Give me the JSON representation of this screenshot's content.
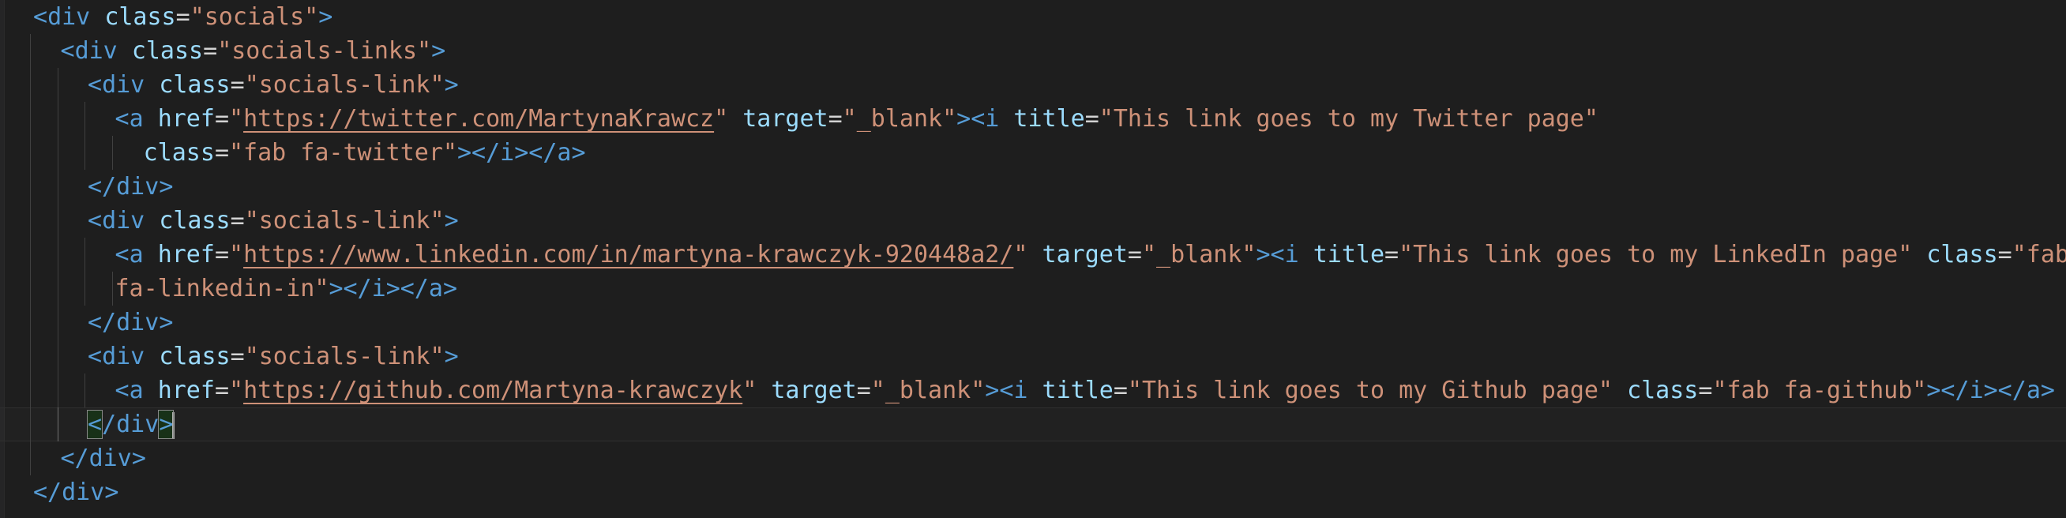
{
  "editor": {
    "language": "html",
    "lines": [
      {
        "indent": 0,
        "tokens": [
          {
            "t": "tag-open",
            "v": "<"
          },
          {
            "t": "tag",
            "v": "div"
          },
          {
            "t": "txt",
            "v": " "
          },
          {
            "t": "attr",
            "v": "class"
          },
          {
            "t": "txt",
            "v": "="
          },
          {
            "t": "str",
            "v": "\"socials\""
          },
          {
            "t": "tag-open",
            "v": ">"
          }
        ]
      },
      {
        "indent": 1,
        "tokens": [
          {
            "t": "tag-open",
            "v": "<"
          },
          {
            "t": "tag",
            "v": "div"
          },
          {
            "t": "txt",
            "v": " "
          },
          {
            "t": "attr",
            "v": "class"
          },
          {
            "t": "txt",
            "v": "="
          },
          {
            "t": "str",
            "v": "\"socials-links\""
          },
          {
            "t": "tag-open",
            "v": ">"
          }
        ]
      },
      {
        "indent": 2,
        "tokens": [
          {
            "t": "tag-open",
            "v": "<"
          },
          {
            "t": "tag",
            "v": "div"
          },
          {
            "t": "txt",
            "v": " "
          },
          {
            "t": "attr",
            "v": "class"
          },
          {
            "t": "txt",
            "v": "="
          },
          {
            "t": "str",
            "v": "\"socials-link\""
          },
          {
            "t": "tag-open",
            "v": ">"
          }
        ]
      },
      {
        "indent": 3,
        "tokens": [
          {
            "t": "tag-open",
            "v": "<"
          },
          {
            "t": "tag",
            "v": "a"
          },
          {
            "t": "txt",
            "v": " "
          },
          {
            "t": "attr",
            "v": "href"
          },
          {
            "t": "txt",
            "v": "="
          },
          {
            "t": "str",
            "v": "\""
          },
          {
            "t": "url",
            "v": "https://twitter.com/MartynaKrawcz"
          },
          {
            "t": "str",
            "v": "\""
          },
          {
            "t": "txt",
            "v": " "
          },
          {
            "t": "attr",
            "v": "target"
          },
          {
            "t": "txt",
            "v": "="
          },
          {
            "t": "str",
            "v": "\"_blank\""
          },
          {
            "t": "tag-open",
            "v": "><"
          },
          {
            "t": "tag",
            "v": "i"
          },
          {
            "t": "txt",
            "v": " "
          },
          {
            "t": "attr",
            "v": "title"
          },
          {
            "t": "txt",
            "v": "="
          },
          {
            "t": "str",
            "v": "\"This link goes to my Twitter page\""
          }
        ]
      },
      {
        "indent": 3,
        "wrap": true,
        "tokens": [
          {
            "t": "txt",
            "v": "  "
          },
          {
            "t": "attr",
            "v": "class"
          },
          {
            "t": "txt",
            "v": "="
          },
          {
            "t": "str",
            "v": "\"fab fa-twitter\""
          },
          {
            "t": "tag-open",
            "v": "></"
          },
          {
            "t": "tag",
            "v": "i"
          },
          {
            "t": "tag-open",
            "v": "></"
          },
          {
            "t": "tag",
            "v": "a"
          },
          {
            "t": "tag-open",
            "v": ">"
          }
        ]
      },
      {
        "indent": 2,
        "tokens": [
          {
            "t": "tag-open",
            "v": "</"
          },
          {
            "t": "tag",
            "v": "div"
          },
          {
            "t": "tag-open",
            "v": ">"
          }
        ]
      },
      {
        "indent": 2,
        "tokens": [
          {
            "t": "tag-open",
            "v": "<"
          },
          {
            "t": "tag",
            "v": "div"
          },
          {
            "t": "txt",
            "v": " "
          },
          {
            "t": "attr",
            "v": "class"
          },
          {
            "t": "txt",
            "v": "="
          },
          {
            "t": "str",
            "v": "\"socials-link\""
          },
          {
            "t": "tag-open",
            "v": ">"
          }
        ]
      },
      {
        "indent": 3,
        "tokens": [
          {
            "t": "tag-open",
            "v": "<"
          },
          {
            "t": "tag",
            "v": "a"
          },
          {
            "t": "txt",
            "v": " "
          },
          {
            "t": "attr",
            "v": "href"
          },
          {
            "t": "txt",
            "v": "="
          },
          {
            "t": "str",
            "v": "\""
          },
          {
            "t": "url",
            "v": "https://www.linkedin.com/in/martyna-krawczyk-920448a2/"
          },
          {
            "t": "str",
            "v": "\""
          },
          {
            "t": "txt",
            "v": " "
          },
          {
            "t": "attr",
            "v": "target"
          },
          {
            "t": "txt",
            "v": "="
          },
          {
            "t": "str",
            "v": "\"_blank\""
          },
          {
            "t": "tag-open",
            "v": "><"
          },
          {
            "t": "tag",
            "v": "i"
          },
          {
            "t": "txt",
            "v": " "
          },
          {
            "t": "attr",
            "v": "title"
          },
          {
            "t": "txt",
            "v": "="
          },
          {
            "t": "str",
            "v": "\"This link goes to my LinkedIn page\""
          },
          {
            "t": "txt",
            "v": " "
          },
          {
            "t": "attr",
            "v": "class"
          },
          {
            "t": "txt",
            "v": "="
          },
          {
            "t": "str",
            "v": "\"fab"
          }
        ]
      },
      {
        "indent": 3,
        "wrap": true,
        "tokens": [
          {
            "t": "str",
            "v": "fa-linkedin-in\""
          },
          {
            "t": "tag-open",
            "v": "></"
          },
          {
            "t": "tag",
            "v": "i"
          },
          {
            "t": "tag-open",
            "v": "></"
          },
          {
            "t": "tag",
            "v": "a"
          },
          {
            "t": "tag-open",
            "v": ">"
          }
        ]
      },
      {
        "indent": 2,
        "tokens": [
          {
            "t": "tag-open",
            "v": "</"
          },
          {
            "t": "tag",
            "v": "div"
          },
          {
            "t": "tag-open",
            "v": ">"
          }
        ]
      },
      {
        "indent": 2,
        "tokens": [
          {
            "t": "tag-open",
            "v": "<"
          },
          {
            "t": "tag",
            "v": "div"
          },
          {
            "t": "txt",
            "v": " "
          },
          {
            "t": "attr",
            "v": "class"
          },
          {
            "t": "txt",
            "v": "="
          },
          {
            "t": "str",
            "v": "\"socials-link\""
          },
          {
            "t": "tag-open",
            "v": ">"
          }
        ]
      },
      {
        "indent": 3,
        "tokens": [
          {
            "t": "tag-open",
            "v": "<"
          },
          {
            "t": "tag",
            "v": "a"
          },
          {
            "t": "txt",
            "v": " "
          },
          {
            "t": "attr",
            "v": "href"
          },
          {
            "t": "txt",
            "v": "="
          },
          {
            "t": "str",
            "v": "\""
          },
          {
            "t": "url",
            "v": "https://github.com/Martyna-krawczyk"
          },
          {
            "t": "str",
            "v": "\""
          },
          {
            "t": "txt",
            "v": " "
          },
          {
            "t": "attr",
            "v": "target"
          },
          {
            "t": "txt",
            "v": "="
          },
          {
            "t": "str",
            "v": "\"_blank\""
          },
          {
            "t": "tag-open",
            "v": "><"
          },
          {
            "t": "tag",
            "v": "i"
          },
          {
            "t": "txt",
            "v": " "
          },
          {
            "t": "attr",
            "v": "title"
          },
          {
            "t": "txt",
            "v": "="
          },
          {
            "t": "str",
            "v": "\"This link goes to my Github page\""
          },
          {
            "t": "txt",
            "v": " "
          },
          {
            "t": "attr",
            "v": "class"
          },
          {
            "t": "txt",
            "v": "="
          },
          {
            "t": "str",
            "v": "\"fab fa-github\""
          },
          {
            "t": "tag-open",
            "v": "></"
          },
          {
            "t": "tag",
            "v": "i"
          },
          {
            "t": "tag-open",
            "v": "></"
          },
          {
            "t": "tag",
            "v": "a"
          },
          {
            "t": "tag-open",
            "v": ">"
          }
        ]
      },
      {
        "indent": 2,
        "current": true,
        "tokens": [
          {
            "t": "match",
            "v": "<"
          },
          {
            "t": "tag-open",
            "v": "/"
          },
          {
            "t": "tag",
            "v": "div"
          },
          {
            "t": "match",
            "v": ">"
          },
          {
            "t": "cursor",
            "v": ""
          }
        ]
      },
      {
        "indent": 1,
        "tokens": [
          {
            "t": "tag-open",
            "v": "</"
          },
          {
            "t": "tag",
            "v": "div"
          },
          {
            "t": "tag-open",
            "v": ">"
          }
        ]
      },
      {
        "indent": 0,
        "tokens": [
          {
            "t": "tag-open",
            "v": "</"
          },
          {
            "t": "tag",
            "v": "div"
          },
          {
            "t": "tag-open",
            "v": ">"
          }
        ]
      }
    ]
  }
}
